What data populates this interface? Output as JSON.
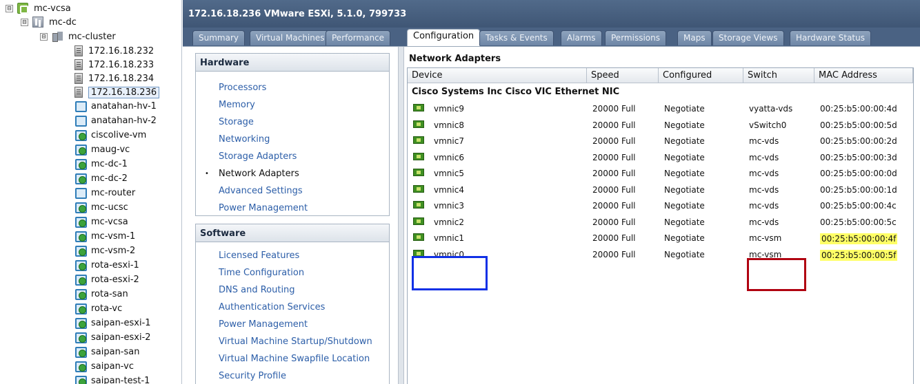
{
  "tree": {
    "root": {
      "expander": "⊟",
      "label": "mc-vcsa",
      "icon": "vcenter-icon"
    },
    "datacenter": {
      "expander": "⊟",
      "label": "mc-dc",
      "icon": "datacenter-icon"
    },
    "cluster": {
      "expander": "⊟",
      "label": "mc-cluster",
      "icon": "cluster-icon"
    },
    "hosts": [
      {
        "label": "172.16.18.232",
        "selected": false
      },
      {
        "label": "172.16.18.233",
        "selected": false
      },
      {
        "label": "172.16.18.234",
        "selected": false
      },
      {
        "label": "172.16.18.236",
        "selected": true
      }
    ],
    "vms": [
      {
        "label": "anatahan-hv-1",
        "on": false
      },
      {
        "label": "anatahan-hv-2",
        "on": false
      },
      {
        "label": "ciscolive-vm",
        "on": true
      },
      {
        "label": "maug-vc",
        "on": true
      },
      {
        "label": "mc-dc-1",
        "on": true
      },
      {
        "label": "mc-dc-2",
        "on": true
      },
      {
        "label": "mc-router",
        "on": false
      },
      {
        "label": "mc-ucsc",
        "on": true
      },
      {
        "label": "mc-vcsa",
        "on": true
      },
      {
        "label": "mc-vsm-1",
        "on": true
      },
      {
        "label": "mc-vsm-2",
        "on": true
      },
      {
        "label": "rota-esxi-1",
        "on": true
      },
      {
        "label": "rota-esxi-2",
        "on": true
      },
      {
        "label": "rota-san",
        "on": true
      },
      {
        "label": "rota-vc",
        "on": true
      },
      {
        "label": "saipan-esxi-1",
        "on": true
      },
      {
        "label": "saipan-esxi-2",
        "on": true
      },
      {
        "label": "saipan-san",
        "on": true
      },
      {
        "label": "saipan-vc",
        "on": true
      },
      {
        "label": "saipan-test-1",
        "on": true
      }
    ]
  },
  "header": {
    "title": "172.16.18.236 VMware ESXi, 5.1.0, 799733"
  },
  "tabs": [
    {
      "label": "Summary",
      "active": false
    },
    {
      "label": "Virtual Machines",
      "active": false
    },
    {
      "label": "Performance",
      "active": false
    },
    {
      "label": "Configuration",
      "active": true
    },
    {
      "label": "Tasks & Events",
      "active": false
    },
    {
      "label": "Alarms",
      "active": false
    },
    {
      "label": "Permissions",
      "active": false
    },
    {
      "label": "Maps",
      "active": false
    },
    {
      "label": "Storage Views",
      "active": false
    },
    {
      "label": "Hardware Status",
      "active": false
    }
  ],
  "hardware": {
    "title": "Hardware",
    "items": [
      "Processors",
      "Memory",
      "Storage",
      "Networking",
      "Storage Adapters",
      "Network Adapters",
      "Advanced Settings",
      "Power Management"
    ],
    "current": "Network Adapters",
    "bullet": "•"
  },
  "software": {
    "title": "Software",
    "items": [
      "Licensed Features",
      "Time Configuration",
      "DNS and Routing",
      "Authentication Services",
      "Power Management",
      "Virtual Machine Startup/Shutdown",
      "Virtual Machine Swapfile Location",
      "Security Profile"
    ]
  },
  "network_adapters": {
    "title": "Network Adapters",
    "columns": [
      "Device",
      "Speed",
      "Configured",
      "Switch",
      "MAC Address"
    ],
    "group": "Cisco Systems Inc Cisco VIC Ethernet NIC",
    "rows": [
      {
        "device": "vmnic9",
        "speed": "20000 Full",
        "configured": "Negotiate",
        "switch": "vyatta-vds",
        "mac": "00:25:b5:00:00:4d",
        "highlight": false
      },
      {
        "device": "vmnic8",
        "speed": "20000 Full",
        "configured": "Negotiate",
        "switch": "vSwitch0",
        "mac": "00:25:b5:00:00:5d",
        "highlight": false
      },
      {
        "device": "vmnic7",
        "speed": "20000 Full",
        "configured": "Negotiate",
        "switch": "mc-vds",
        "mac": "00:25:b5:00:00:2d",
        "highlight": false
      },
      {
        "device": "vmnic6",
        "speed": "20000 Full",
        "configured": "Negotiate",
        "switch": "mc-vds",
        "mac": "00:25:b5:00:00:3d",
        "highlight": false
      },
      {
        "device": "vmnic5",
        "speed": "20000 Full",
        "configured": "Negotiate",
        "switch": "mc-vds",
        "mac": "00:25:b5:00:00:0d",
        "highlight": false
      },
      {
        "device": "vmnic4",
        "speed": "20000 Full",
        "configured": "Negotiate",
        "switch": "mc-vds",
        "mac": "00:25:b5:00:00:1d",
        "highlight": false
      },
      {
        "device": "vmnic3",
        "speed": "20000 Full",
        "configured": "Negotiate",
        "switch": "mc-vds",
        "mac": "00:25:b5:00:00:4c",
        "highlight": false
      },
      {
        "device": "vmnic2",
        "speed": "20000 Full",
        "configured": "Negotiate",
        "switch": "mc-vds",
        "mac": "00:25:b5:00:00:5c",
        "highlight": false
      },
      {
        "device": "vmnic1",
        "speed": "20000 Full",
        "configured": "Negotiate",
        "switch": "mc-vsm",
        "mac": "00:25:b5:00:00:4f",
        "highlight": true
      },
      {
        "device": "vmnic0",
        "speed": "20000 Full",
        "configured": "Negotiate",
        "switch": "mc-vsm",
        "mac": "00:25:b5:00:00:5f",
        "highlight": true
      }
    ]
  },
  "colors": {
    "header_bg": "#4a6283",
    "link": "#2c5ea8",
    "highlight_yellow": "#ffff66",
    "box_blue": "#1030e6",
    "box_red": "#b00010"
  }
}
